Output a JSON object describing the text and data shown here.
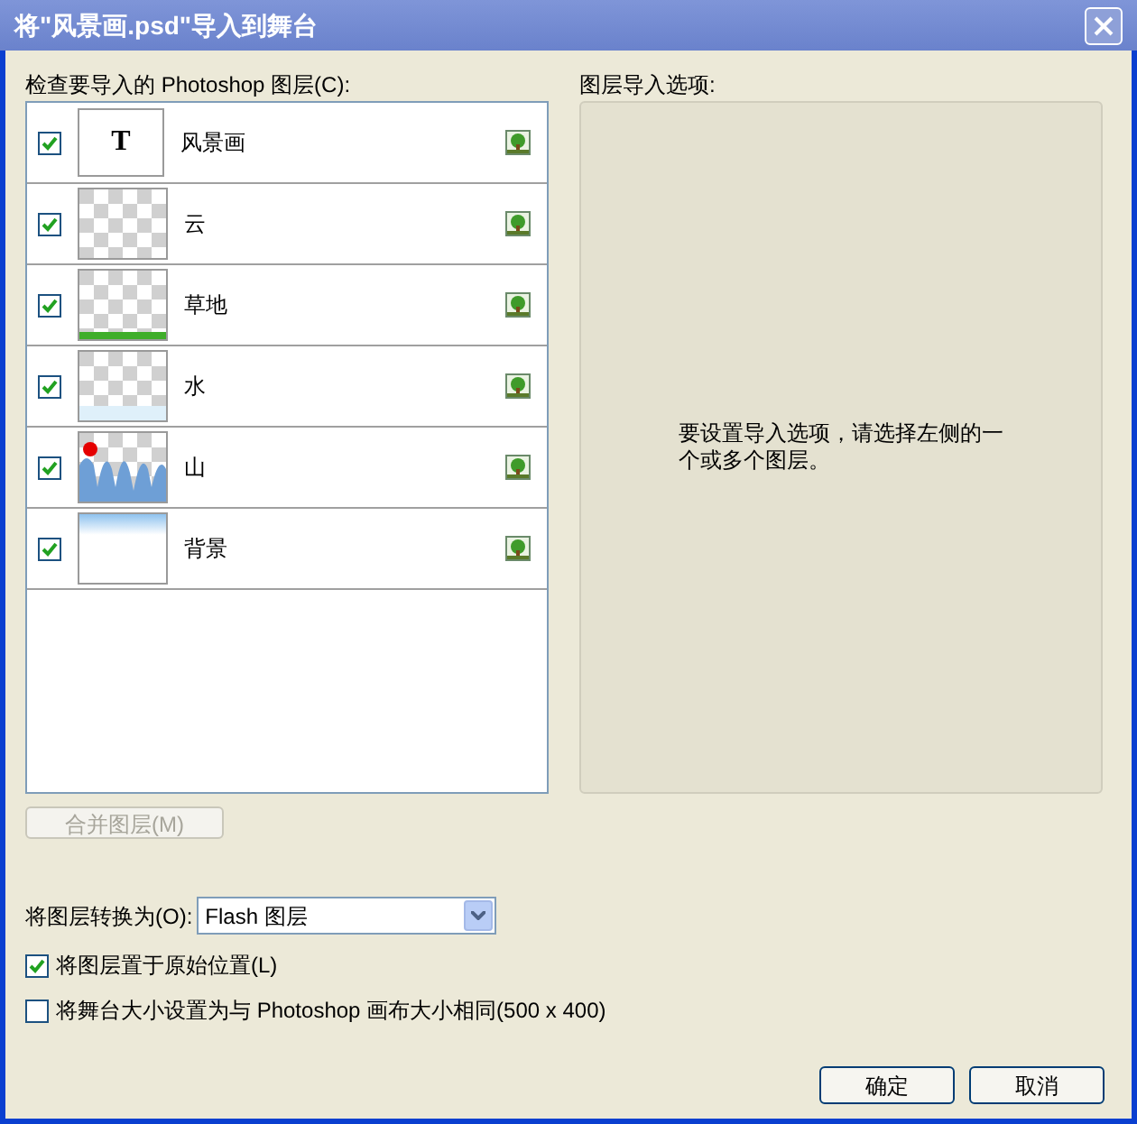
{
  "window": {
    "title": "将\"风景画.psd\"导入到舞台"
  },
  "layers_label": "检查要导入的 Photoshop 图层(C):",
  "layers": [
    {
      "name": "风景画",
      "checked": true,
      "kind": "text",
      "thumb_glyph": "T"
    },
    {
      "name": "云",
      "checked": true,
      "kind": "transparent"
    },
    {
      "name": "草地",
      "checked": true,
      "kind": "grass"
    },
    {
      "name": "水",
      "checked": true,
      "kind": "water"
    },
    {
      "name": "山",
      "checked": true,
      "kind": "mountain"
    },
    {
      "name": "背景",
      "checked": true,
      "kind": "sky"
    }
  ],
  "merge_button": {
    "label": "合并图层(M)",
    "disabled": true
  },
  "options_label": "图层导入选项:",
  "options_message": "要设置导入选项，请选择左侧的一个或多个图层。",
  "convert": {
    "label": "将图层转换为(O):",
    "value": "Flash 图层"
  },
  "checkboxes": [
    {
      "label": "将图层置于原始位置(L)",
      "checked": true
    },
    {
      "label": "将舞台大小设置为与 Photoshop 画布大小相同(500 x 400)",
      "checked": false
    }
  ],
  "buttons": [
    "确定",
    "取消"
  ]
}
